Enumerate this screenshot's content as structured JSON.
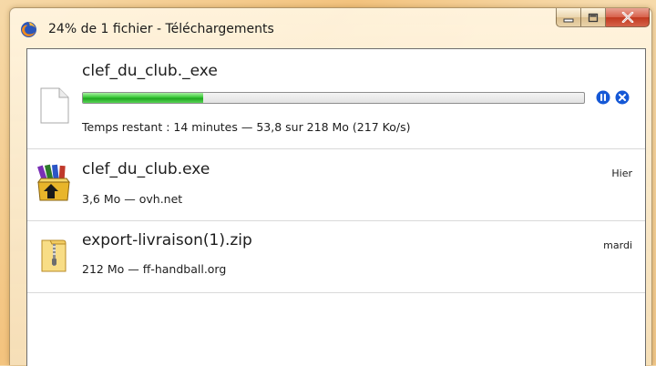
{
  "window": {
    "title": "24% de 1 fichier - Téléchargements",
    "icon": "firefox-icon",
    "controls": [
      "minimize-icon",
      "maximize-icon",
      "close-icon"
    ]
  },
  "colors": {
    "progress": "#2fbf2e",
    "accent_blue": "#1558d6",
    "close_red": "#c8412a"
  },
  "downloads": [
    {
      "filename": "clef_du_club._exe",
      "icon": "blank-file-icon",
      "progress_percent": 24,
      "status": "Temps restant : 14 minutes — 53,8 sur 218 Mo (217 Ko/s)",
      "actions": [
        "pause-icon",
        "cancel-icon"
      ]
    },
    {
      "filename": "clef_du_club.exe",
      "icon": "winrar-archive-icon",
      "status": "3,6 Mo — ovh.net",
      "when": "Hier"
    },
    {
      "filename": "export-livraison(1).zip",
      "icon": "zip-folder-icon",
      "status": "212 Mo — ff-handball.org",
      "when": "mardi"
    }
  ]
}
